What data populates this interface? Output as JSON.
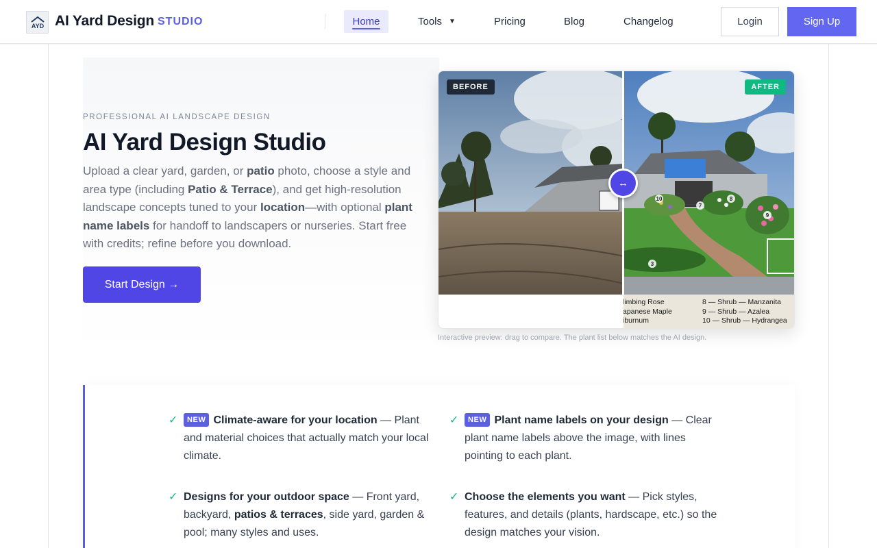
{
  "brand": {
    "name": "AI Yard Design",
    "suffix": "STUDIO",
    "logo_text": "AYD"
  },
  "nav": {
    "home": "Home",
    "tools": "Tools",
    "tools_caret": "▼",
    "pricing": "Pricing",
    "blog": "Blog",
    "changelog": "Changelog",
    "login": "Login",
    "signup": "Sign Up"
  },
  "hero": {
    "eyebrow": "PROFESSIONAL AI LANDSCAPE DESIGN",
    "title": "AI Yard Design Studio",
    "desc_parts": {
      "p1": "Upload a clear yard, garden, or ",
      "b1": "patio",
      "p2": " photo, choose a style and area type (including ",
      "b2": "Patio & Terrace",
      "p3": "), and get high-resolution landscape concepts tuned to your ",
      "b3": "location",
      "p4": "—with optional ",
      "b4": "plant name labels",
      "p5": " for handoff to landscapers or nurseries. Start free with credits; refine before you download."
    },
    "cta": "Start Design →"
  },
  "preview": {
    "before_label": "BEFORE",
    "after_label": "AFTER",
    "handle_icon": "↔",
    "markers": [
      "10",
      "7",
      "8",
      "9",
      "3"
    ],
    "legend_left": [
      "limbing Rose",
      "apanese Maple",
      "iburnum"
    ],
    "legend_right": [
      "8 — Shrub — Manzanita",
      "9 — Shrub — Azalea",
      "10 — Shrub — Hydrangea"
    ],
    "caption": "Interactive preview: drag to compare. The plant list below matches the AI design."
  },
  "features": [
    {
      "badge": "NEW",
      "title": "Climate-aware for your location",
      "text": " — Plant and material choices that actually match your local climate."
    },
    {
      "badge": "NEW",
      "title": "Plant name labels on your design",
      "text": " — Clear plant name labels above the image, with lines pointing to each plant."
    },
    {
      "title": "Designs for your outdoor space",
      "text_a": " — Front yard, backyard, ",
      "bold_b": "patios & terraces",
      "text_c": ", side yard, garden & pool; many styles and uses."
    },
    {
      "title": "Choose the elements you want",
      "text": " — Pick styles, features, and details (plants, hardscape, etc.) so the design matches your vision."
    }
  ],
  "check_icon": "✓",
  "colors": {
    "accent": "#6366f1",
    "primary_button": "#4f46e5",
    "success": "#10b981"
  }
}
